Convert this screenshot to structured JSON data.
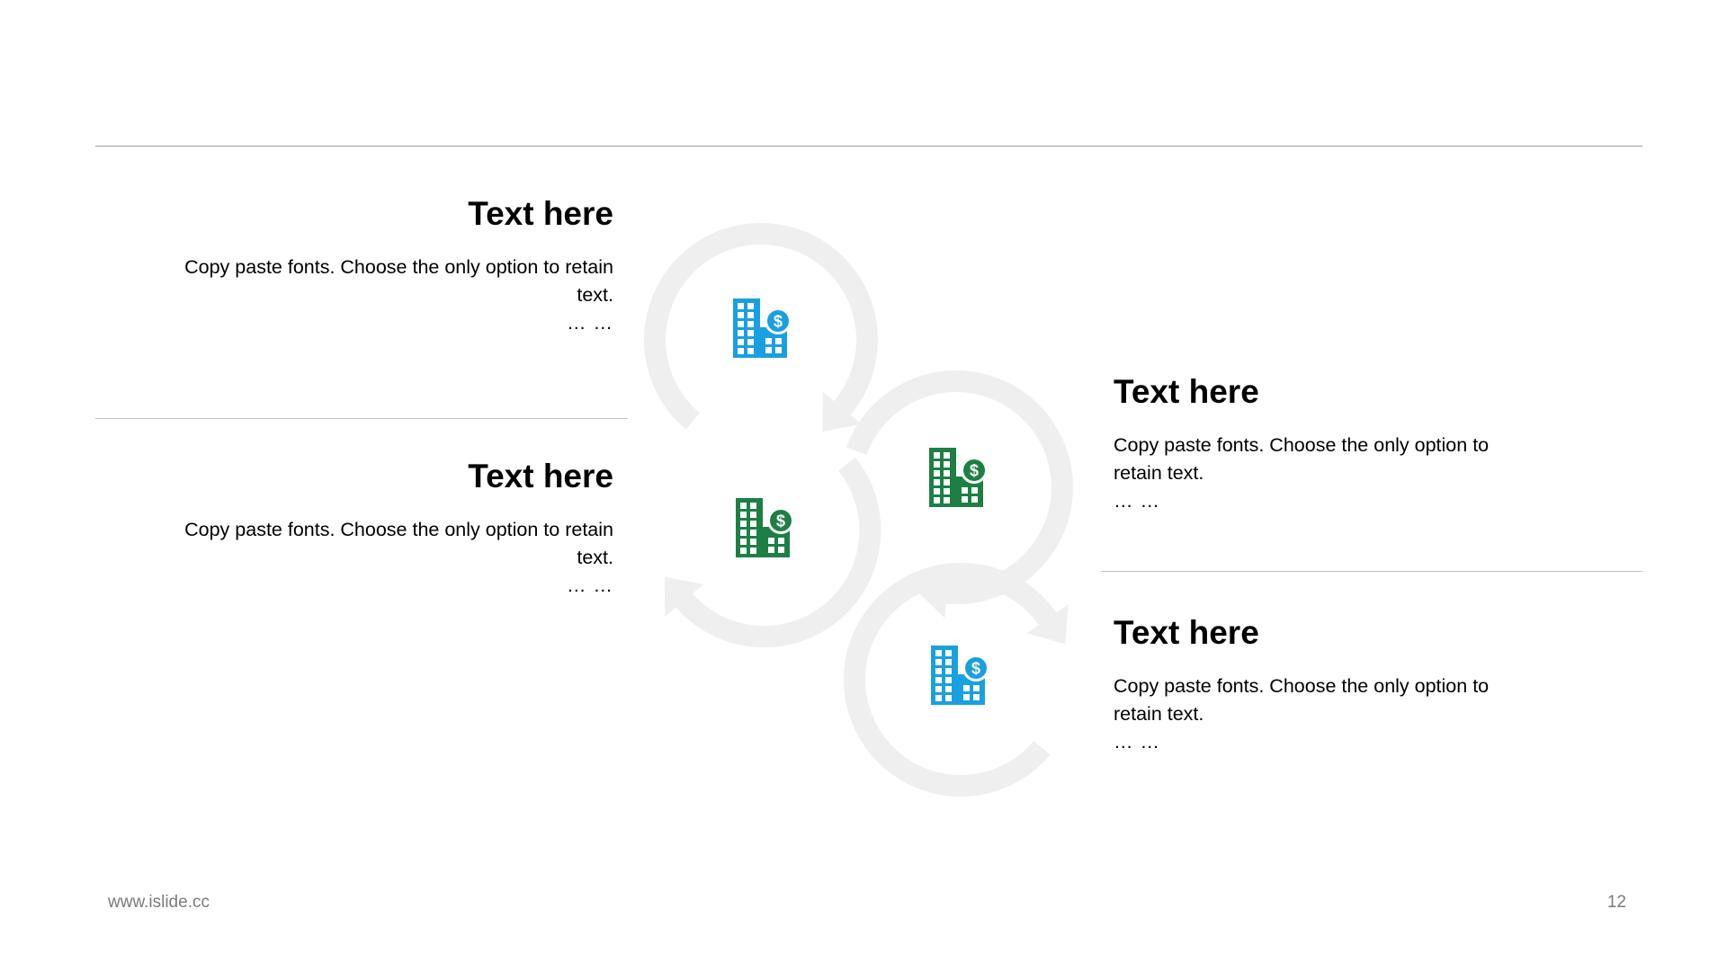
{
  "blocks": [
    {
      "title": "Text here",
      "body": "Copy paste fonts. Choose the only option to retain text.",
      "ellipsis": "… …"
    },
    {
      "title": "Text here",
      "body": "Copy paste fonts. Choose the only option to retain text.",
      "ellipsis": "… …"
    },
    {
      "title": "Text here",
      "body": "Copy paste fonts. Choose the only option to retain text.",
      "ellipsis": "… …"
    },
    {
      "title": "Text here",
      "body": "Copy paste fonts. Choose the only option to retain text.",
      "ellipsis": "… …"
    }
  ],
  "icons": [
    {
      "name": "building-dollar-icon",
      "color": "#1aa0e0"
    },
    {
      "name": "building-dollar-icon",
      "color": "#1e7f45"
    },
    {
      "name": "building-dollar-icon",
      "color": "#1e7f45"
    },
    {
      "name": "building-dollar-icon",
      "color": "#1aa0e0"
    }
  ],
  "colors": {
    "arrow_ring": "#efefef",
    "blue": "#1aa0e0",
    "green": "#1e7f45",
    "divider": "#9c9c9c"
  },
  "footer": {
    "url": "www.islide.cc",
    "page": "12"
  }
}
